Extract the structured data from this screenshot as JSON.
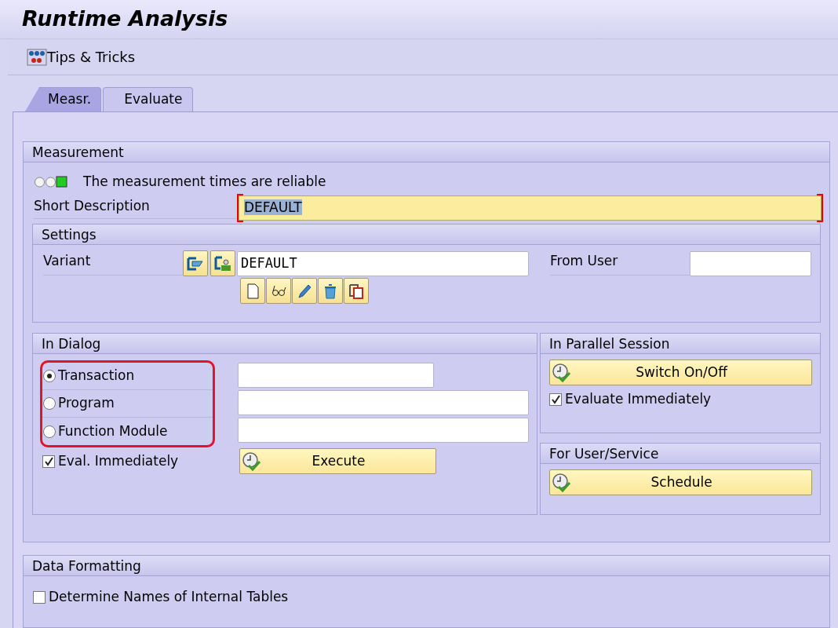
{
  "window": {
    "title": "Runtime Analysis"
  },
  "toolbar": [
    {
      "label": "Tips & Tricks"
    }
  ],
  "tabs": [
    {
      "label": "Measr.",
      "selected": true
    },
    {
      "label": "Evaluate",
      "selected": false
    }
  ],
  "measurement": {
    "title": "Measurement",
    "status_lights": [
      {
        "on": false
      },
      {
        "on": false
      },
      {
        "on": true
      }
    ],
    "status_text": "The measurement times are reliable",
    "short_description": {
      "label": "Short Description",
      "value": "DEFAULT",
      "focused": true
    }
  },
  "settings": {
    "title": "Settings",
    "variant_label": "Variant",
    "variant_value": "DEFAULT",
    "from_user_label": "From User"
  },
  "in_dialog": {
    "title": "In Dialog",
    "options": [
      {
        "label": "Transaction",
        "selected": true
      },
      {
        "label": "Program",
        "selected": false
      },
      {
        "label": "Function Module",
        "selected": false
      }
    ],
    "eval_checkbox": {
      "label": "Eval. Immediately",
      "checked": true
    },
    "button": "Execute"
  },
  "parallel_session": {
    "title": "In Parallel Session",
    "button": "Switch On/Off",
    "checkbox": {
      "label": "Evaluate Immediately",
      "checked": true
    }
  },
  "for_user": {
    "title": "For User/Service",
    "button": "Schedule"
  },
  "data_formatting": {
    "title": "Data Formatting",
    "checkbox": {
      "label": "Determine Names of Internal Tables",
      "checked": false
    }
  }
}
